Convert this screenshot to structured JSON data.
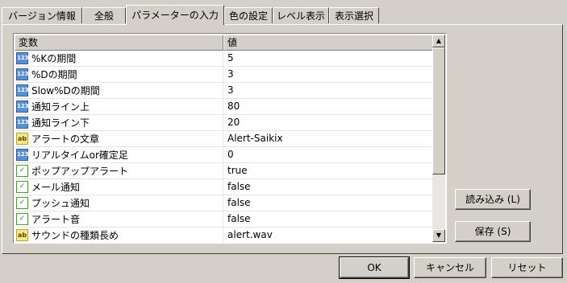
{
  "tabs": [
    {
      "label": "バージョン情報"
    },
    {
      "label": "全般"
    },
    {
      "label": "パラメーターの入力"
    },
    {
      "label": "色の設定"
    },
    {
      "label": "レベル表示"
    },
    {
      "label": "表示選択"
    }
  ],
  "grid": {
    "col_name": "変数",
    "col_value": "値",
    "rows": [
      {
        "icon": "123",
        "name": "%Kの期間",
        "value": "5"
      },
      {
        "icon": "123",
        "name": "%Dの期間",
        "value": "3"
      },
      {
        "icon": "123",
        "name": "Slow%Dの期間",
        "value": "3"
      },
      {
        "icon": "123",
        "name": "通知ライン上",
        "value": "80"
      },
      {
        "icon": "123",
        "name": "通知ライン下",
        "value": "20"
      },
      {
        "icon": "ab",
        "name": "アラートの文章",
        "value": "Alert-Saikix"
      },
      {
        "icon": "123",
        "name": "リアルタイムor確定足",
        "value": "0"
      },
      {
        "icon": "✓",
        "name": "ポップアップアラート",
        "value": "true"
      },
      {
        "icon": "✓",
        "name": "メール通知",
        "value": "false"
      },
      {
        "icon": "✓",
        "name": "プッシュ通知",
        "value": "false"
      },
      {
        "icon": "✓",
        "name": "アラート音",
        "value": "false"
      },
      {
        "icon": "ab",
        "name": "サウンドの種類長め",
        "value": "alert.wav"
      }
    ]
  },
  "buttons": {
    "load": "読み込み (L)",
    "save": "保存 (S)",
    "ok": "OK",
    "cancel": "キャンセル",
    "reset": "リセット"
  }
}
